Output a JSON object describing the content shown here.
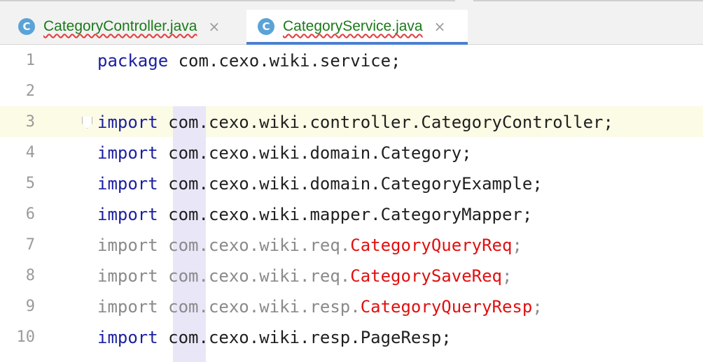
{
  "tabs": [
    {
      "icon": "class-icon",
      "icon_letter": "C",
      "name": "CategoryController.java",
      "active": false
    },
    {
      "icon": "class-icon",
      "icon_letter": "C",
      "name": "CategoryService.java",
      "active": true
    }
  ],
  "close_glyph": "×",
  "colors": {
    "keyword": "#1b1fa0",
    "unused_import": "#8a8a8a",
    "error": "#e01010",
    "tab_active_underline": "#4a7fd3",
    "file_name": "#1a7a1a"
  },
  "editor": {
    "lines": [
      {
        "num": "1",
        "kw": "package",
        "pre": " com.cexo.wiki.service;",
        "err": "",
        "post": ""
      },
      {
        "num": "2",
        "kw": "",
        "pre": "",
        "err": "",
        "post": ""
      },
      {
        "num": "3",
        "kw": "import",
        "pre": " com.cexo.wiki.controller.CategoryController;",
        "err": "",
        "post": ""
      },
      {
        "num": "4",
        "kw": "import",
        "pre": " com.cexo.wiki.domain.Category;",
        "err": "",
        "post": ""
      },
      {
        "num": "5",
        "kw": "import",
        "pre": " com.cexo.wiki.domain.CategoryExample;",
        "err": "",
        "post": ""
      },
      {
        "num": "6",
        "kw": "import",
        "pre": " com.cexo.wiki.mapper.CategoryMapper;",
        "err": "",
        "post": ""
      },
      {
        "num": "7",
        "kw": "import",
        "pre": " com.cexo.wiki.req.",
        "err": "CategoryQueryReq",
        "post": ";"
      },
      {
        "num": "8",
        "kw": "import",
        "pre": " com.cexo.wiki.req.",
        "err": "CategorySaveReq",
        "post": ";"
      },
      {
        "num": "9",
        "kw": "import",
        "pre": " com.cexo.wiki.resp.",
        "err": "CategoryQueryResp",
        "post": ";"
      },
      {
        "num": "10",
        "kw": "import",
        "pre": " com.cexo.wiki.resp.PageResp;",
        "err": "",
        "post": ""
      }
    ]
  }
}
